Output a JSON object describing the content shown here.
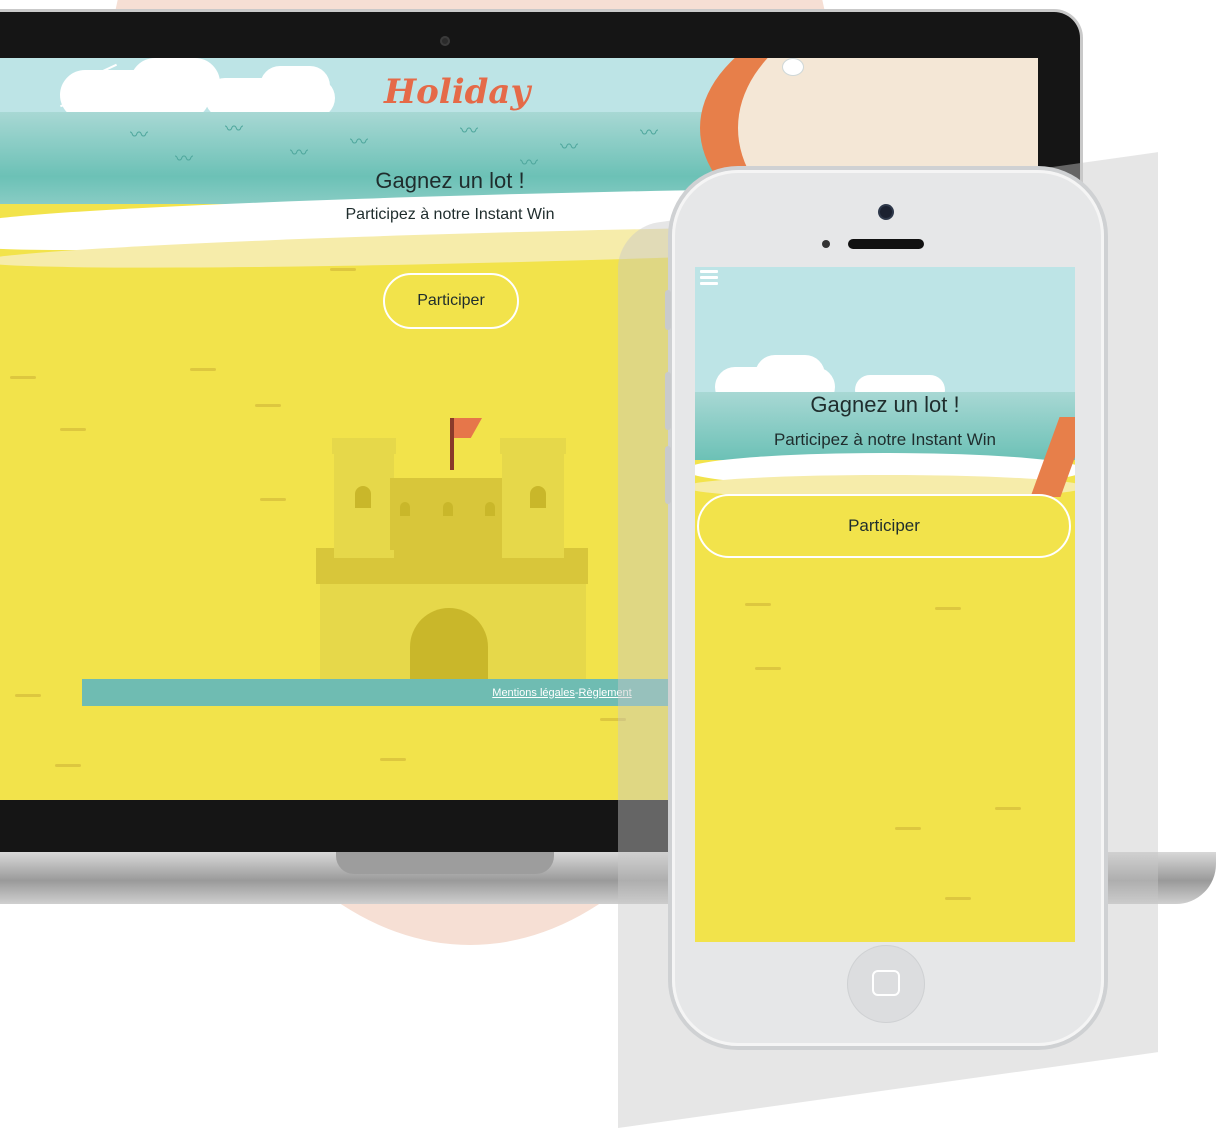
{
  "desktop": {
    "logo_text": "Holiday",
    "title": "Gagnez un lot !",
    "subtitle": "Participez à notre Instant Win",
    "cta_label": "Participer",
    "footer": {
      "legal_link": "Mentions légales",
      "separator": " - ",
      "rules_link": "Règlement"
    }
  },
  "mobile": {
    "title": "Gagnez un lot !",
    "subtitle": "Participez à notre Instant Win",
    "cta_label": "Participer",
    "menu_icon": "hamburger-menu-icon",
    "home_icon": "home-button-square-icon"
  },
  "colors": {
    "sand": "#f2e34b",
    "sea": "#6cc1b6",
    "sky": "#bde4e6",
    "footer_teal": "#6fbcb2",
    "logo_coral": "#e56a48",
    "background_circle": "#f6dfd4"
  }
}
